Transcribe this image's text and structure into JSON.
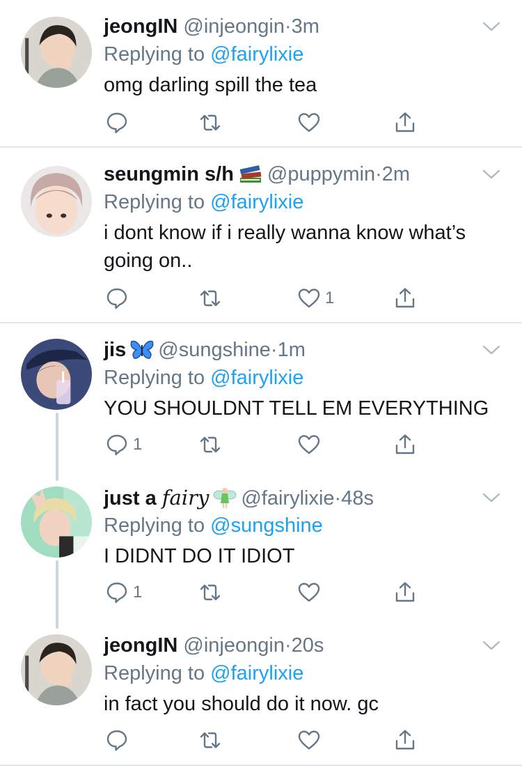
{
  "tweets": [
    {
      "name": "jeongIN",
      "handle": "@injeongin",
      "time": "3m",
      "replying_prefix": "Replying to",
      "replying_to": "@fairylixie",
      "text": "omg darling spill the tea",
      "reply_count": "",
      "like_count": ""
    },
    {
      "name": "seungmin s/h",
      "name_emoji": "books-emoji",
      "handle": "@puppymin",
      "time": "2m",
      "replying_prefix": "Replying to",
      "replying_to": "@fairylixie",
      "text": "i dont know if i really wanna know what’s going on..",
      "reply_count": "",
      "like_count": "1"
    },
    {
      "name": "jis",
      "name_emoji": "butterfly-emoji",
      "handle": "@sungshine",
      "time": "1m",
      "replying_prefix": "Replying to",
      "replying_to": "@fairylixie",
      "text": "YOU SHOULDNT TELL EM EVERYTHING",
      "reply_count": "1",
      "like_count": ""
    },
    {
      "name": "just a",
      "name_styled": "fairy",
      "name_emoji": "fairy-emoji",
      "handle": "@fairylixie",
      "time": "48s",
      "replying_prefix": "Replying to",
      "replying_to": "@sungshine",
      "text": "I DIDNT DO IT IDIOT",
      "reply_count": "1",
      "like_count": ""
    },
    {
      "name": "jeongIN",
      "handle": "@injeongin",
      "time": "20s",
      "replying_prefix": "Replying to",
      "replying_to": "@fairylixie",
      "text": "in fact you should do it now. gc",
      "reply_count": "",
      "like_count": ""
    }
  ],
  "separator": "·",
  "colors": {
    "text": "#14171a",
    "secondary": "#657786",
    "link": "#1da1f2",
    "divider": "#e1e8ed",
    "thread_line": "#ccd6dd"
  }
}
